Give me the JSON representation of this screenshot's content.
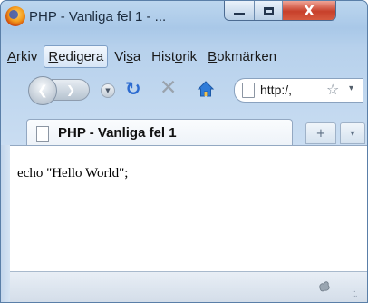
{
  "window": {
    "title": "PHP - Vanliga fel 1 - ...",
    "buttons": {
      "minimize": "–",
      "maximize": "□",
      "close": "X"
    }
  },
  "menubar": {
    "items": [
      {
        "label": "Arkiv",
        "active": false
      },
      {
        "label": "Redigera",
        "active": true
      },
      {
        "label": "Visa",
        "active": false
      },
      {
        "label": "Historik",
        "active": false
      },
      {
        "label": "Bokmärken",
        "active": false
      }
    ]
  },
  "navbar": {
    "url": "http:/,",
    "icons": [
      "back-icon",
      "forward-icon",
      "history-dropdown-icon",
      "reload-icon",
      "stop-icon",
      "home-icon",
      "page-icon",
      "bookmark-star-icon"
    ]
  },
  "tabs": {
    "active_title": "PHP - Vanliga fel 1",
    "new_tab_symbol": "+",
    "list_symbol": "▾"
  },
  "content": {
    "text": "echo \"Hello World\";"
  },
  "colors": {
    "chrome": "#b9d1ea",
    "close_button": "#c7402b",
    "reload": "#2c6bd0",
    "page_background": "#ffffff"
  }
}
